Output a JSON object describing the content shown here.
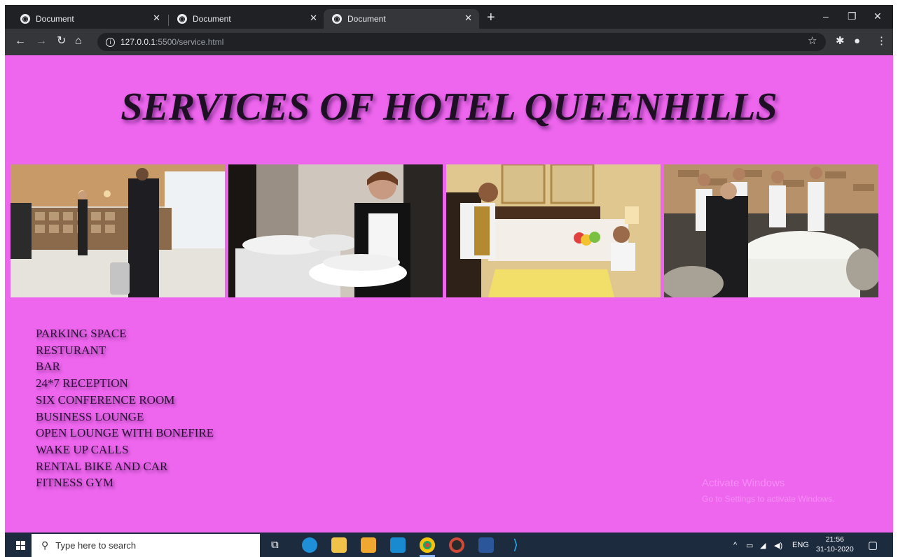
{
  "browser": {
    "tabs": [
      {
        "title": "Document"
      },
      {
        "title": "Document"
      },
      {
        "title": "Document"
      }
    ],
    "url_host": "127.0.0.1",
    "url_path": ":5500/service.html"
  },
  "page": {
    "title": "SERVICES OF HOTEL QUEENHILLS",
    "services": [
      "PARKING SPACE",
      "RESTURANT",
      "BAR",
      "24*7 RECEPTION",
      "SIX CONFERENCE ROOM",
      "BUSINESS LOUNGE",
      "OPEN LOUNGE WITH BONEFIRE",
      "WAKE UP CALLS",
      "RENTAL BIKE AND CAR",
      "FITNESS GYM"
    ],
    "watermark": {
      "line1": "Activate Windows",
      "line2": "Go to Settings to activate Windows."
    },
    "background_color": "#ee66ee"
  },
  "taskbar": {
    "search_placeholder": "Type here to search",
    "language": "ENG",
    "time": "21:56",
    "date": "31-10-2020"
  }
}
